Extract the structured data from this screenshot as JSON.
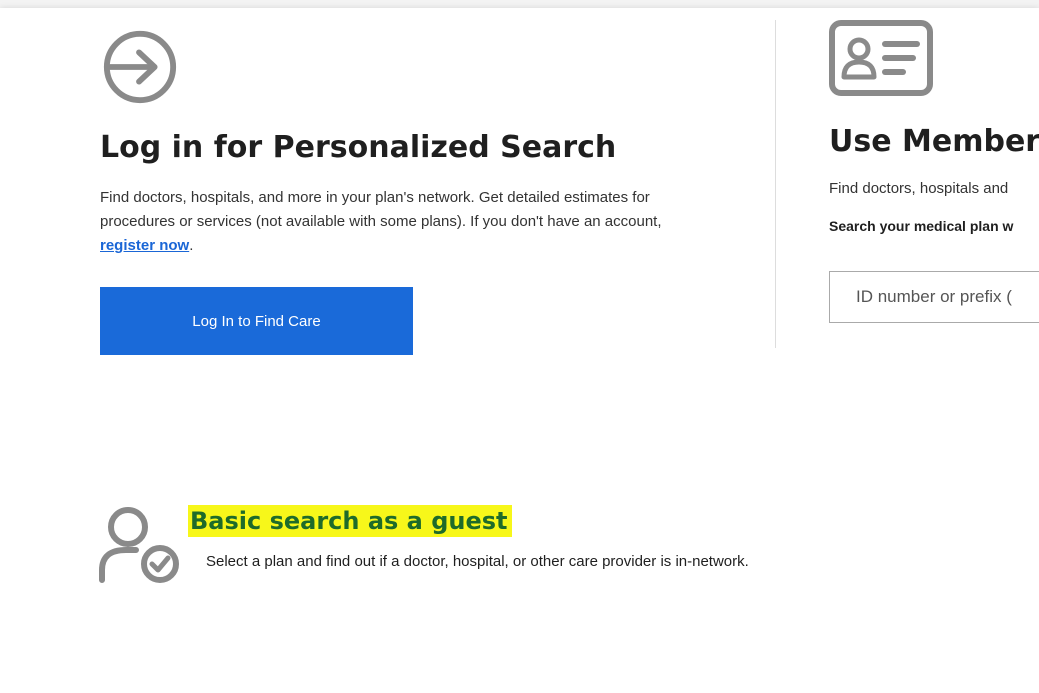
{
  "login": {
    "icon": "arrow-circle-right-icon",
    "title": "Log in for Personalized Search",
    "description": "Find doctors, hospitals, and more in your plan's network. Get detailed estimates for procedures or services (not available with some plans). If you don't have an account, ",
    "register_link": "register now",
    "description_end": ".",
    "button_label": "Log In to Find Care",
    "button_color": "#1a6ad9"
  },
  "member": {
    "icon": "id-card-icon",
    "title": "Use Member",
    "description": "Find doctors, hospitals and",
    "search_label": "Search your medical plan w",
    "input_placeholder": "ID number or prefix ("
  },
  "guest": {
    "icon": "user-check-icon",
    "title": "Basic search as a guest",
    "description": "Select a plan and find out if a doctor, hospital, or other care provider is in-network.",
    "highlight_color": "#f7f71a"
  }
}
